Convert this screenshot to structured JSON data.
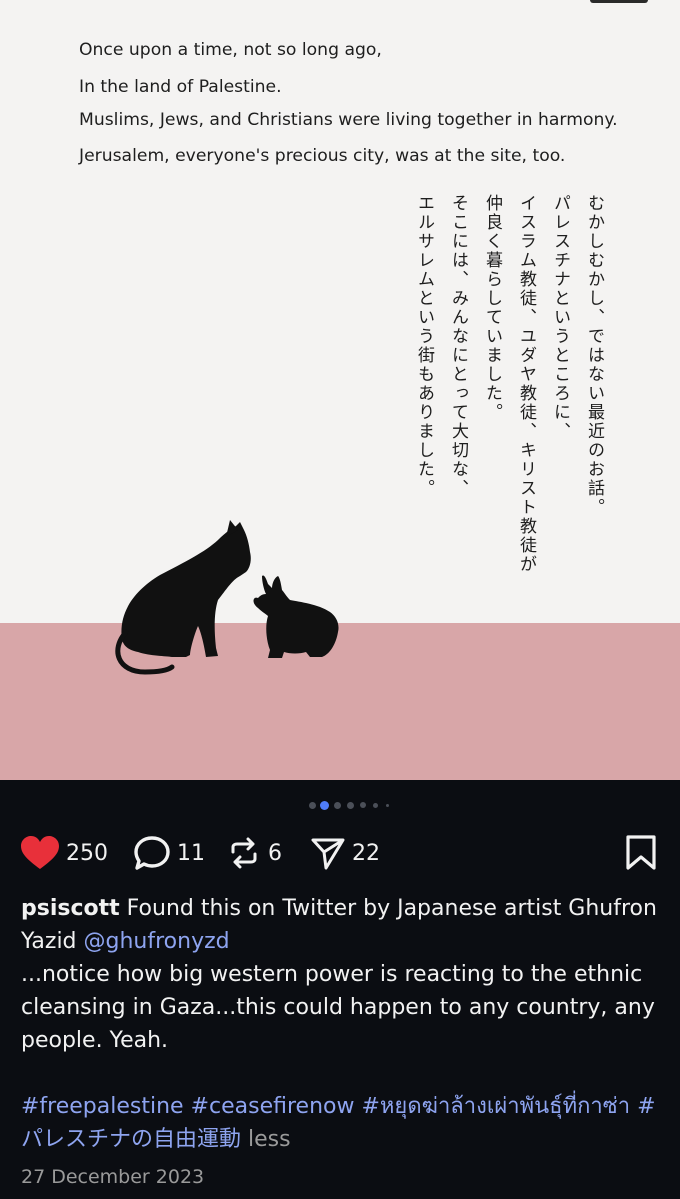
{
  "post": {
    "english_lines": [
      "Once upon a time, not so long ago,",
      "In the land of Palestine.",
      "Muslims, Jews, and Christians were living together in harmony.",
      "Jerusalem, everyone's precious city, was at the site, too."
    ],
    "japanese_columns": [
      "むかしむかし、ではない最近のお話。",
      "パレスチナというところに、",
      "イスラム教徒、ユダヤ教徒、キリスト教徒が",
      "仲良く暮らしていました。",
      "そこには、みんなにとって大切な、",
      "エルサレムという街もありました。"
    ],
    "colors": {
      "paper": "#f4f3f2",
      "floor": "#d8a6a8",
      "accent_like": "#e8303a",
      "link": "#8ea4f0"
    }
  },
  "carousel": {
    "total": 6,
    "active_index": 1
  },
  "actions": {
    "likes": "250",
    "comments": "11",
    "reposts": "6",
    "shares": "22"
  },
  "caption": {
    "username": "psiscott",
    "text_1": " Found this on Twitter by Japanese artist Ghufron Yazid ",
    "mention": "@ghufronyzd",
    "text_2": "...notice how big western power is reacting to the ethnic cleansing in Gaza...this could happen to any country, any people. Yeah.",
    "hashtags": [
      "#freepalestine",
      "#ceasefirenow",
      "#หยุดฆ่าล้างเผ่าพันธุ์ที่กาซ่า",
      "#パレスチナの自由運動"
    ],
    "less_label": "less"
  },
  "date": "27 December 2023"
}
